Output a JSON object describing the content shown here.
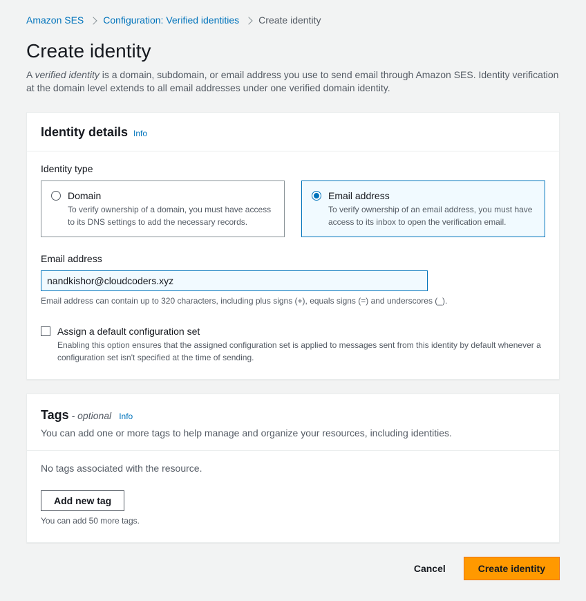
{
  "breadcrumb": {
    "root": "Amazon SES",
    "mid": "Configuration: Verified identities",
    "current": "Create identity"
  },
  "page": {
    "title": "Create identity",
    "desc_pre": "A ",
    "desc_em": "verified identity",
    "desc_post": " is a domain, subdomain, or email address you use to send email through Amazon SES. Identity verification at the domain level extends to all email addresses under one verified domain identity."
  },
  "details": {
    "heading": "Identity details",
    "info": "Info",
    "type_label": "Identity type",
    "domain": {
      "title": "Domain",
      "desc": "To verify ownership of a domain, you must have access to its DNS settings to add the necessary records."
    },
    "email": {
      "title": "Email address",
      "desc": "To verify ownership of an email address, you must have access to its inbox to open the verification email."
    },
    "email_field_label": "Email address",
    "email_value": "nandkishor@cloudcoders.xyz",
    "email_hint": "Email address can contain up to 320 characters, including plus signs (+), equals signs (=) and underscores (_).",
    "assign_label": "Assign a default configuration set",
    "assign_hint": "Enabling this option ensures that the assigned configuration set is applied to messages sent from this identity by default whenever a configuration set isn't specified at the time of sending."
  },
  "tags": {
    "heading": "Tags",
    "optional": " - optional",
    "info": "Info",
    "desc": "You can add one or more tags to help manage and organize your resources, including identities.",
    "none": "No tags associated with the resource.",
    "add_btn": "Add new tag",
    "limit": "You can add 50 more tags."
  },
  "footer": {
    "cancel": "Cancel",
    "submit": "Create identity"
  }
}
